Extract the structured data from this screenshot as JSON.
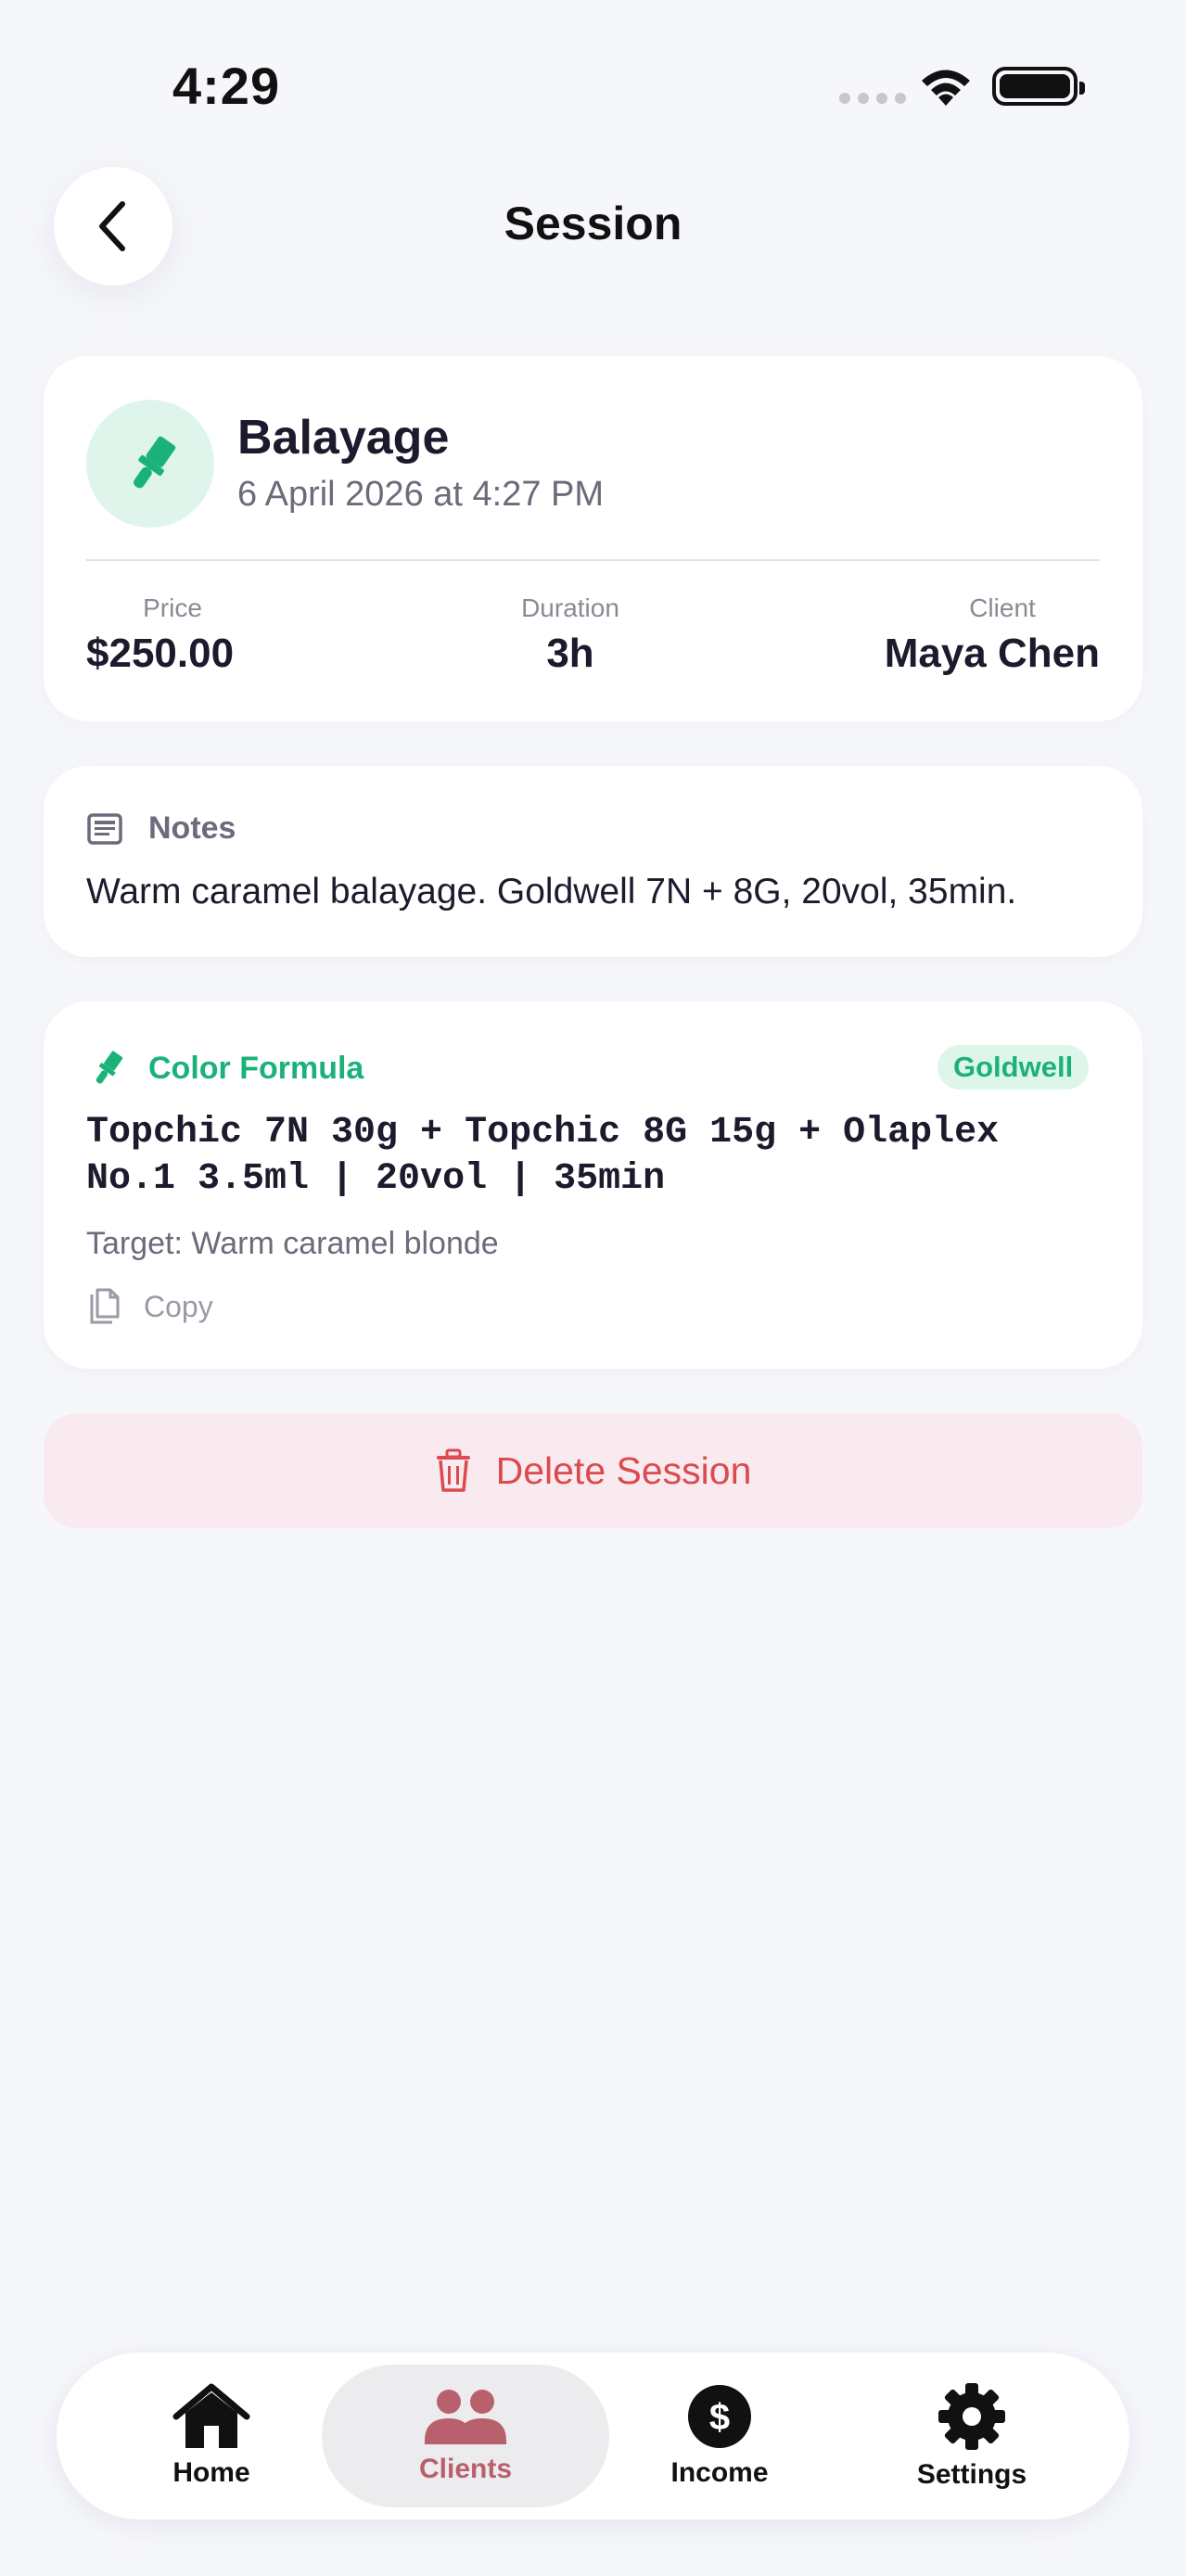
{
  "status_bar": {
    "time": "4:29"
  },
  "nav": {
    "title": "Session"
  },
  "session": {
    "service": "Balayage",
    "datetime": "6 April 2026 at 4:27 PM",
    "stats": [
      {
        "label": "Price",
        "value": "$250.00"
      },
      {
        "label": "Duration",
        "value": "3h"
      },
      {
        "label": "Client",
        "value": "Maya Chen"
      }
    ]
  },
  "notes": {
    "title": "Notes",
    "text": "Warm caramel balayage. Goldwell 7N + 8G, 20vol, 35min."
  },
  "formula": {
    "title": "Color Formula",
    "brand": "Goldwell",
    "line1": "Topchic 7N 30g + Topchic 8G 15g + Olaplex",
    "line2": "No.1 3.5ml | 20vol | 35min",
    "target": "Target: Warm caramel blonde",
    "copy_label": "Copy"
  },
  "delete_label": "Delete Session",
  "tabs": [
    {
      "label": "Home",
      "icon": "house-icon",
      "active": false
    },
    {
      "label": "Clients",
      "icon": "people-icon",
      "active": true
    },
    {
      "label": "Income",
      "icon": "dollar-icon",
      "active": false
    },
    {
      "label": "Settings",
      "icon": "gear-icon",
      "active": false
    }
  ],
  "colors": {
    "accent_green": "#1bb27a",
    "danger_red": "#dc4a4f",
    "active_tab": "#b9606d",
    "background": "#f6f7fb"
  }
}
